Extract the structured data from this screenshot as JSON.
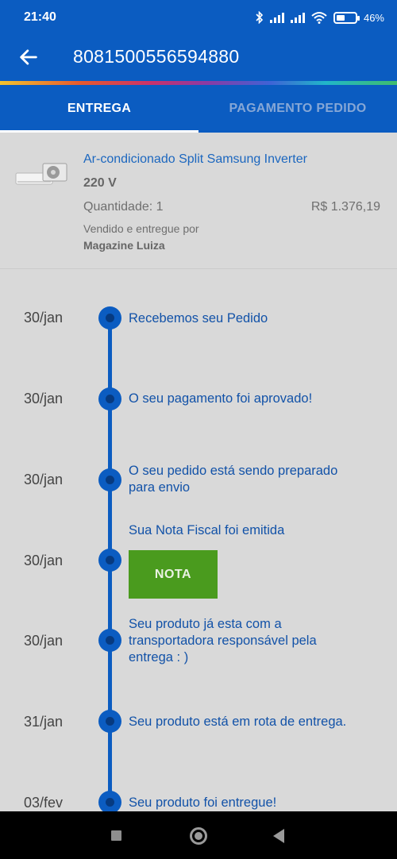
{
  "status": {
    "time": "21:40",
    "battery": "46",
    "battery_level": 0.46
  },
  "header": {
    "title": "8081500556594880"
  },
  "tabs": [
    {
      "label": "ENTREGA",
      "active": true
    },
    {
      "label": "PAGAMENTO PEDIDO",
      "active": false
    }
  ],
  "product": {
    "name": "Ar-condicionado Split Samsung Inverter",
    "voltage": "220 V",
    "quantity": "Quantidade: 1",
    "price": "R$ 1.376,19",
    "sold_by_label": "Vendido e entregue por",
    "seller": "Magazine Luiza"
  },
  "timeline": [
    {
      "date": "30/jan",
      "text": "Recebemos seu Pedido"
    },
    {
      "date": "30/jan",
      "text": "O seu pagamento foi aprovado!"
    },
    {
      "date": "30/jan",
      "text": "O seu pedido está sendo preparado para envio"
    },
    {
      "date": "30/jan",
      "text": "Sua Nota Fiscal foi emitida",
      "button": "NOTA"
    },
    {
      "date": "30/jan",
      "text": "Seu produto já esta com a transportadora responsável pela entrega : )"
    },
    {
      "date": "31/jan",
      "text": "Seu produto está em rota de entrega."
    },
    {
      "date": "03/fev",
      "text": "Seu produto foi entregue!"
    }
  ],
  "colors": {
    "primary": "#0b5cc1",
    "button_green": "#4a9b1e",
    "link_blue": "#1c67bf"
  }
}
